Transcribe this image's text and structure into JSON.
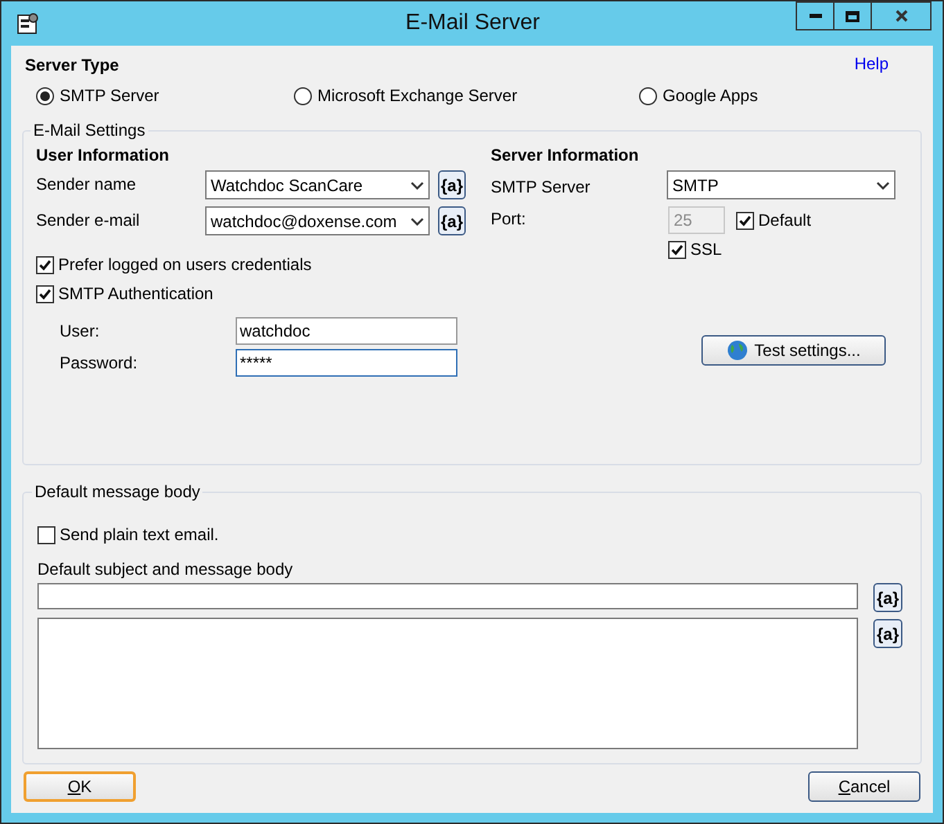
{
  "window": {
    "title": "E-Mail Server"
  },
  "help_link": "Help",
  "server_type": {
    "title": "Server Type",
    "options": [
      {
        "label": "SMTP Server",
        "selected": true
      },
      {
        "label": "Microsoft Exchange Server",
        "selected": false
      },
      {
        "label": "Google Apps",
        "selected": false
      }
    ]
  },
  "email_settings": {
    "title": "E-Mail Settings",
    "user_information": {
      "title": "User Information",
      "sender_name": {
        "label": "Sender name",
        "value": "Watchdoc ScanCare",
        "variable_button": "{a}"
      },
      "sender_email": {
        "label": "Sender e-mail",
        "value": "watchdoc@doxense.com",
        "variable_button": "{a}"
      },
      "options": [
        {
          "label": "Prefer logged on users credentials",
          "checked": true
        },
        {
          "label": "SMTP Authentication",
          "checked": true
        }
      ],
      "user": {
        "label": "User:",
        "value": "watchdoc"
      },
      "password": {
        "label": "Password:",
        "value": "*****"
      }
    },
    "server_information": {
      "title": "Server Information",
      "smtp_server": {
        "label": "SMTP Server",
        "value": "SMTP"
      },
      "port": {
        "label": "Port:",
        "value": "25",
        "disabled": true
      },
      "default": {
        "label": "Default",
        "checked": true
      },
      "ssl": {
        "label": "SSL",
        "checked": true
      },
      "test_button": "Test settings..."
    }
  },
  "default_message_body": {
    "title": "Default message body",
    "plain_text": {
      "label": "Send plain text email.",
      "checked": false
    },
    "subject_label": "Default subject and message body",
    "subject_variable_button": "{a}",
    "body_variable_button": "{a}"
  },
  "buttons": [
    {
      "label": "OK",
      "default": true
    },
    {
      "label": "Cancel",
      "default": false
    }
  ]
}
